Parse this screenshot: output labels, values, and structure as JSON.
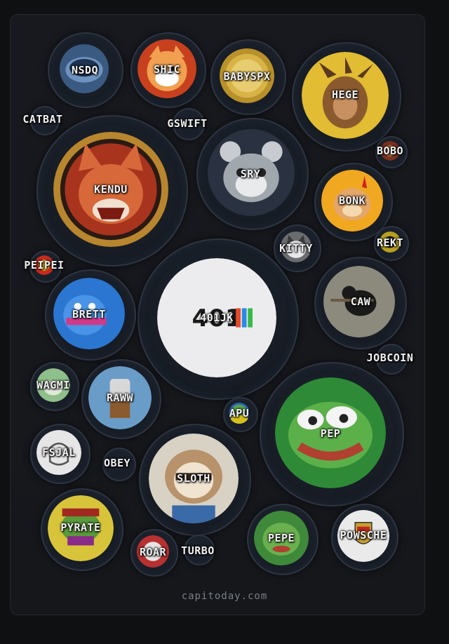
{
  "tokens": [
    {
      "symbol": "NSDQ",
      "color": "#4b6f9a"
    },
    {
      "symbol": "SHIC",
      "color": "#e0673a"
    },
    {
      "symbol": "BABYSPX",
      "color": "#c9a233"
    },
    {
      "symbol": "HEGE",
      "color": "#e6c23c"
    },
    {
      "symbol": "CATBAT",
      "color": "#2a3342"
    },
    {
      "symbol": "GSWIFT",
      "color": "#2a3342"
    },
    {
      "symbol": "BOBO",
      "color": "#8a3a2a"
    },
    {
      "symbol": "KENDU",
      "color": "#c8553a"
    },
    {
      "symbol": "SRY",
      "color": "#9aa2a6"
    },
    {
      "symbol": "BONK",
      "color": "#f0a020"
    },
    {
      "symbol": "KITTY",
      "color": "#8e8f92"
    },
    {
      "symbol": "REKT",
      "color": "#c8b020"
    },
    {
      "symbol": "PEIPEI",
      "color": "#d23a2a"
    },
    {
      "symbol": "401JK",
      "color": "#e8e8ea"
    },
    {
      "symbol": "BRETT",
      "color": "#2f7fd6"
    },
    {
      "symbol": "CAW",
      "color": "#8a8a7a"
    },
    {
      "symbol": "JOBCOIN",
      "color": "#2a3342"
    },
    {
      "symbol": "WAGMI",
      "color": "#8fbf8a"
    },
    {
      "symbol": "RAWW",
      "color": "#6fa0c8"
    },
    {
      "symbol": "APU",
      "color": "#4caf50"
    },
    {
      "symbol": "PEP",
      "color": "#3a9a3a"
    },
    {
      "symbol": "FSJAL",
      "color": "#e4e4e4"
    },
    {
      "symbol": "OBEY",
      "color": "#2a3342"
    },
    {
      "symbol": "SLOTH",
      "color": "#d9d0c0"
    },
    {
      "symbol": "PYRATE",
      "color": "#d6c23a"
    },
    {
      "symbol": "PEPE",
      "color": "#4a9a4a"
    },
    {
      "symbol": "POWSCHE",
      "color": "#e6e6e6"
    },
    {
      "symbol": "ROAR",
      "color": "#c83a3a"
    },
    {
      "symbol": "TURBO",
      "color": "#2a3342"
    }
  ],
  "footer": {
    "text": "capitoday.com"
  }
}
